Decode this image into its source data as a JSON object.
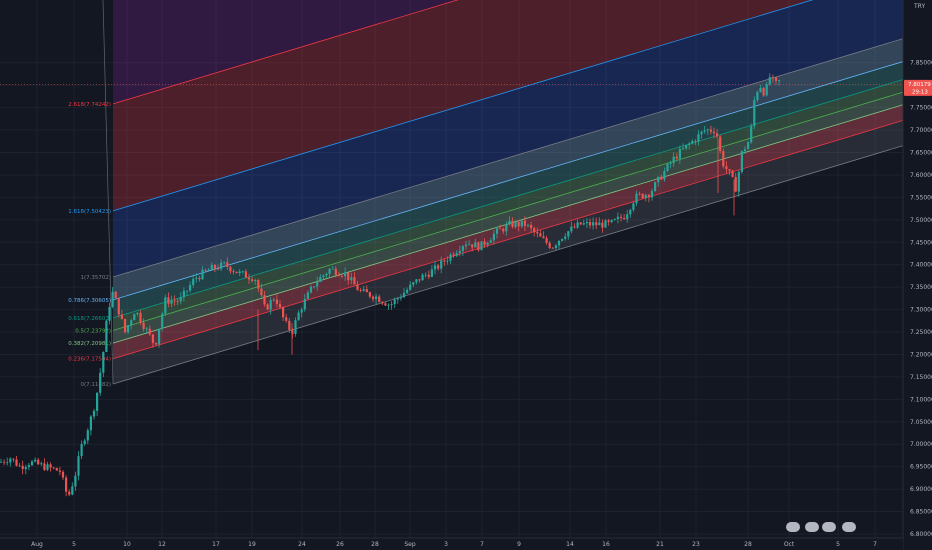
{
  "chart_data": {
    "type": "candlestick",
    "currency": "TRY",
    "y_ticks": [
      "7.85000",
      "7.80000",
      "7.75000",
      "7.70000",
      "7.65000",
      "7.60000",
      "7.55000",
      "7.50000",
      "7.45000",
      "7.40000",
      "7.35000",
      "7.30000",
      "7.25000",
      "7.20000",
      "7.15000",
      "7.10000",
      "7.05000",
      "7.00000",
      "6.95000",
      "6.90000",
      "6.85000",
      "6.80000"
    ],
    "x_ticks": [
      "Aug",
      "5",
      "10",
      "12",
      "17",
      "19",
      "24",
      "26",
      "28",
      "Sep",
      "3",
      "7",
      "9",
      "14",
      "16",
      "21",
      "23",
      "28",
      "Oct",
      "5",
      "7"
    ],
    "ylim": [
      6.78,
      7.98
    ],
    "last_price": "7.80179",
    "countdown": "29:13",
    "fib_levels": [
      {
        "label": "2.618(7.74242)",
        "ratio": 2.618
      },
      {
        "label": "1.618(7.50423)",
        "ratio": 1.618
      },
      {
        "label": "1(7.35702)",
        "ratio": 1
      },
      {
        "label": "0.786(7.30605)",
        "ratio": 0.786
      },
      {
        "label": "0.618(7.26603)",
        "ratio": 0.618
      },
      {
        "label": "0.5(7.23792)",
        "ratio": 0.5
      },
      {
        "label": "0.382(7.20981)",
        "ratio": 0.382
      },
      {
        "label": "0.236(7.17504)",
        "ratio": 0.236
      },
      {
        "label": "0(7.11882)",
        "ratio": 0
      }
    ],
    "colors": {
      "up": "#26a69a",
      "down": "#ef5350",
      "background": "#131722",
      "grid": "#1e222d"
    }
  }
}
